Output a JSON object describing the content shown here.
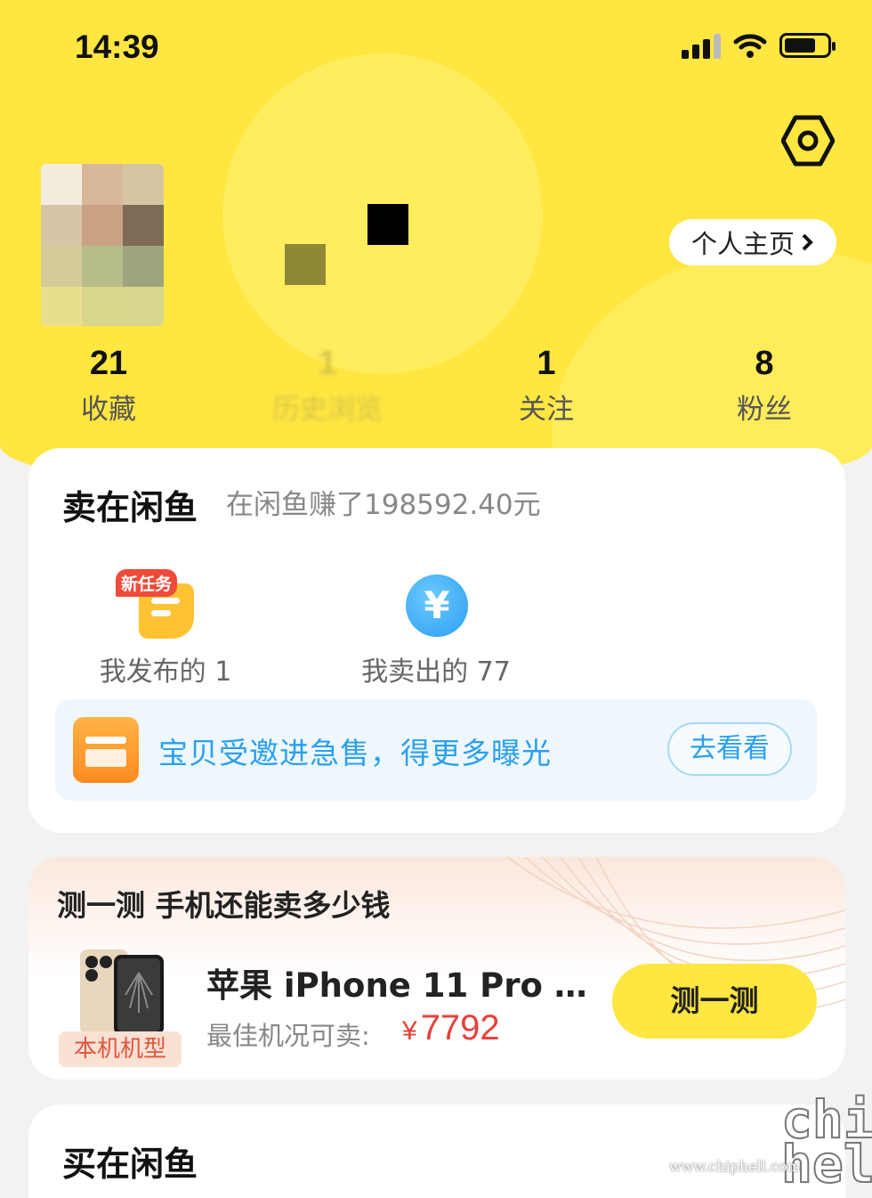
{
  "status_bar": {
    "time": "14:39"
  },
  "header": {
    "profile_button": "个人主页",
    "stats": [
      {
        "value": "21",
        "label": "收藏"
      },
      {
        "value": "1",
        "label": "历史浏览"
      },
      {
        "value": "1",
        "label": "关注"
      },
      {
        "value": "8",
        "label": "粉丝"
      }
    ]
  },
  "sell_section": {
    "title": "卖在闲鱼",
    "subtitle": "在闲鱼赚了198592.40元",
    "items": [
      {
        "label": "我发布的 1",
        "badge": "新任务",
        "icon": "document-icon"
      },
      {
        "label": "我卖出的 77",
        "icon": "yen-coin-icon"
      }
    ],
    "promo": {
      "text": "宝贝受邀进急售，得更多曝光",
      "button": "去看看"
    }
  },
  "test_section": {
    "title": "测一测 手机还能卖多少钱",
    "phone_tag": "本机机型",
    "phone_name": "苹果 iPhone 11 Pro …",
    "price_label": "最佳机况可卖:",
    "price_symbol": "¥",
    "price": "7792",
    "button": "测一测"
  },
  "buy_section": {
    "title": "买在闲鱼"
  },
  "watermark": {
    "url": "www.chiphell.com",
    "logo": "chip hell"
  },
  "colors": {
    "brand_yellow": "#ffe640",
    "link_blue": "#2a9ff0",
    "price_red": "#e8403a"
  }
}
